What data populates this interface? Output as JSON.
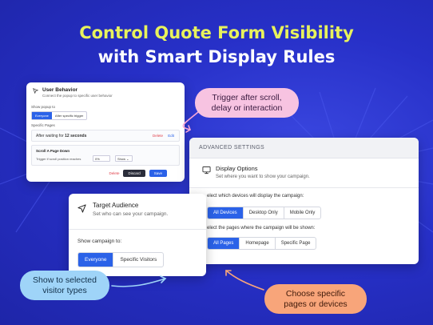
{
  "headline": {
    "line1": "Control Quote Form Visibility",
    "line2": "with Smart Display Rules"
  },
  "colors": {
    "background": "#2730c8",
    "headline_accent": "#e8f25c",
    "primary_blue": "#2b62e8",
    "pill_pink": "#f7c3e1",
    "pill_blue": "#9fd4f8",
    "pill_orange": "#f8a57a"
  },
  "user_behavior": {
    "icon": "cursor-arrow-icon",
    "title": "User Behavior",
    "subtitle": "Connect the popup to specific user behavior",
    "show_popup_label": "Show popup to",
    "options": [
      "Everyone",
      "After specific trigger"
    ],
    "selected": "Everyone",
    "pages_label": "Specific Pages",
    "wait_text": "After waiting for",
    "wait_value": "12 seconds",
    "delete_label": "Delete",
    "edit_label": "Edit",
    "scroll_title": "Scroll A Page Down",
    "scroll_text": "Trigger if scroll position reaches",
    "scroll_value": "0%",
    "scroll_select": "Show",
    "footer": {
      "delete": "Delete",
      "discard": "Discard",
      "save": "Save"
    }
  },
  "advanced": {
    "header": "ADVANCED SETTINGS",
    "icon": "monitor-icon",
    "title": "Display Options",
    "subtitle": "Set where you want to show your campaign.",
    "devices_question": "elect which devices will display the campaign:",
    "devices": [
      "All Devices",
      "Desktop Only",
      "Mobile Only"
    ],
    "devices_selected": "All Devices",
    "pages_question": "elect the pages where the campaign will be shown:",
    "pages": [
      "All Pages",
      "Homepage",
      "Specific Page"
    ],
    "pages_selected": "All Pages"
  },
  "audience": {
    "icon": "send-arrow-icon",
    "title": "Target Audience",
    "subtitle": "Set who can see your campaign.",
    "question": "Show campaign to:",
    "options": [
      "Everyone",
      "Specific Visitors"
    ],
    "selected": "Everyone"
  },
  "callouts": {
    "trigger": {
      "line1": "Trigger after scroll,",
      "line2": "delay or interaction"
    },
    "visitors": {
      "line1": "Show to selected",
      "line2": "visitor types"
    },
    "pages": {
      "line1": "Choose specific",
      "line2": "pages or devices"
    }
  }
}
